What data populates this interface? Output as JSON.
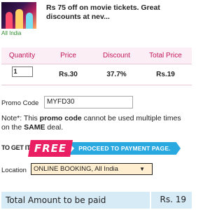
{
  "deal": {
    "title": "Rs 75 off on movie tickets. Great discounts at nev...",
    "location": "All India",
    "thumbnail": "movie-audience-image"
  },
  "table": {
    "headers": [
      "Quantity",
      "Price",
      "Discount",
      "Total Price"
    ],
    "row": {
      "quantity": "1",
      "price": "Rs.30",
      "discount": "37.7%",
      "total_price": "Rs.19"
    }
  },
  "promo": {
    "label": "Promo Code",
    "value": "MYFD30"
  },
  "note": {
    "prefix": "Note*: This ",
    "bold1": "promo code",
    "middle": " cannot be used multiple times on the ",
    "bold2": "SAME",
    "suffix": " deal."
  },
  "banner": {
    "to_get_it": "TO GET IT",
    "free": "FREE",
    "proceed": "PROCEED TO PAYMENT PAGE.",
    "colors": {
      "free": "#e91e63",
      "proceed": "#29a9e0"
    }
  },
  "location_select": {
    "label": "Location",
    "selected": "ONLINE BOOKING, All India",
    "arrow_icon": "dropdown-arrow-icon"
  },
  "total": {
    "label": "Total Amount to be paid",
    "value": "Rs. 19"
  },
  "colors": {
    "accent_pink": "#c2185b",
    "header_bg": "#fbeef4",
    "total_bg": "#d7ebf7",
    "select_bg": "#ffeecf"
  }
}
